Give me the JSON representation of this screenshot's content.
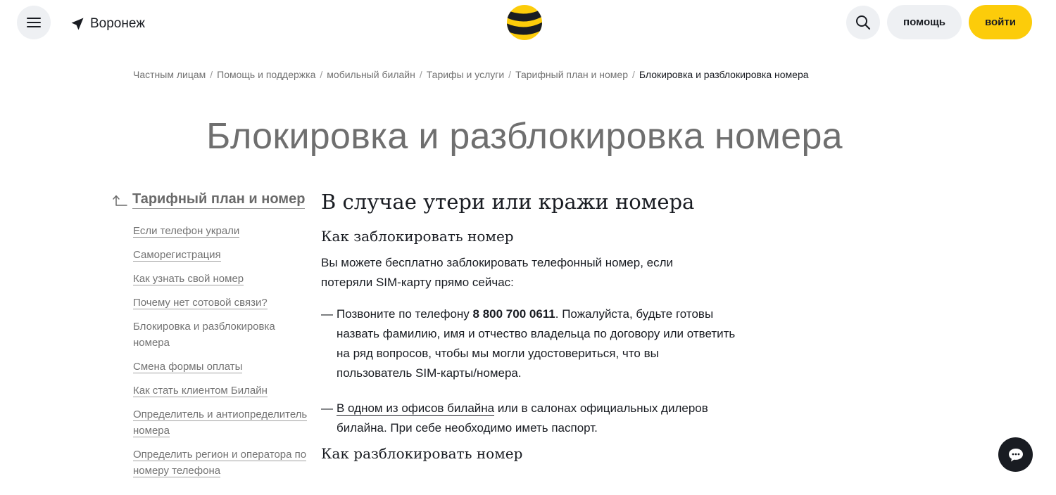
{
  "header": {
    "city": "Воронеж",
    "help_label": "помощь",
    "login_label": "войти",
    "colors": {
      "accent_yellow": "#fccc0a",
      "dark": "#191c22",
      "pill_bg": "#eef0f3"
    }
  },
  "breadcrumbs": [
    "Частным лицам",
    "Помощь и поддержка",
    "мобильный билайн",
    "Тарифы и услуги",
    "Тарифный план и номер",
    "Блокировка и разблокировка номера"
  ],
  "breadcrumb_separator": "/",
  "page_title": "Блокировка и разблокировка номера",
  "sidebar": {
    "parent": "Тарифный план и номер",
    "items": [
      {
        "label": "Если телефон украли",
        "active": false
      },
      {
        "label": "Саморегистрация",
        "active": false
      },
      {
        "label": "Как узнать свой номер",
        "active": false
      },
      {
        "label": "Почему нет сотовой связи?",
        "active": false
      },
      {
        "label": "Блокировка и разблокировка номера",
        "active": true
      },
      {
        "label": "Смена формы оплаты",
        "active": false
      },
      {
        "label": "Как стать клиентом Билайн",
        "active": false
      },
      {
        "label": "Определитель и антиопределитель номера",
        "active": false
      },
      {
        "label": "Определить регион и оператора по номеру телефона",
        "active": false
      }
    ]
  },
  "content": {
    "heading": "В случае утери или кражи номера",
    "block_heading": "Как заблокировать номер",
    "intro": "Вы можете бесплатно заблокировать телефонный номер, если потеряли SIM-карту прямо сейчас:",
    "bullet_dash": "—",
    "bullet1_prefix": "Позвоните по телефону ",
    "bullet1_phone": "8 800 700 0611",
    "bullet1_suffix": ". Пожалуйста, будьте готовы назвать фамилию, имя и отчество владельца по договору или ответить на ряд вопросов, чтобы мы могли удостовериться, что вы пользователь SIM-карты/номера.",
    "bullet2_link": "В одном из офисов билайна",
    "bullet2_suffix": " или в салонах официальных дилеров билайна. При себе необходимо иметь паспорт.",
    "unblock_heading": "Как разблокировать номер"
  },
  "icons": {
    "menu": "hamburger-icon",
    "city": "location-arrow-icon",
    "logo": "beeline-logo",
    "search": "search-icon",
    "back": "back-arrow-icon",
    "chat": "chat-icon"
  }
}
